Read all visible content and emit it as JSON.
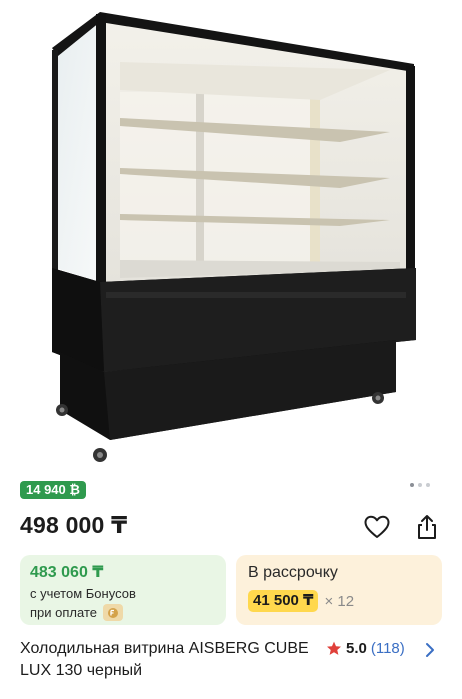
{
  "gallery": {
    "image_name": "product-photo",
    "page_count": 3,
    "active_page": 1
  },
  "bonus_badge": {
    "text": "14 940 ₿"
  },
  "price": {
    "main": "498 000 ₸"
  },
  "bonus_card": {
    "price": "483 060 ₸",
    "note_line1": "с учетом Бонусов",
    "note_line2": "при оплате",
    "coin_icon": "bonus-coin-icon"
  },
  "installment_card": {
    "label": "В рассрочку",
    "monthly_price": "41 500 ₸",
    "multiplier": "× 12"
  },
  "product": {
    "title": "Холодильная витрина AISBERG CUBE LUX 130 черный",
    "rating": "5.0",
    "reviews": "(118)"
  },
  "colors": {
    "green": "#2f9a4e",
    "yellow": "#ffd84d",
    "star": "#e0403a",
    "link": "#3b6fc4"
  }
}
